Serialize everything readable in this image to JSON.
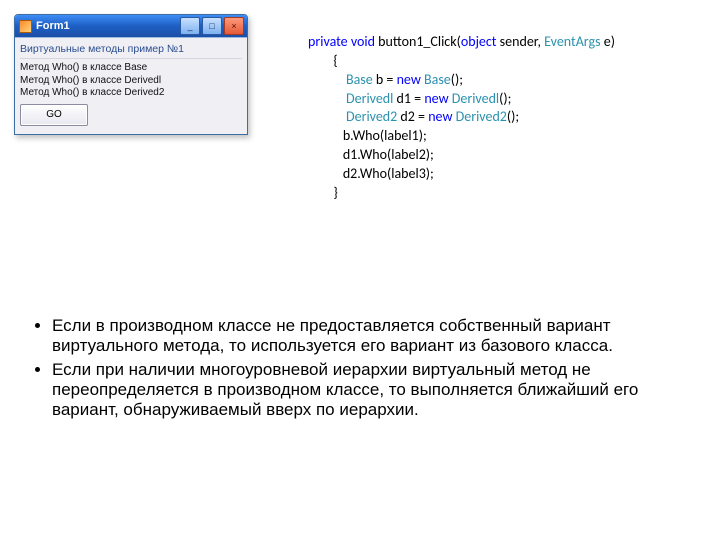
{
  "form": {
    "title": "Form1",
    "heading": "Виртуальные методы пример №1",
    "lines": [
      "Метод Who() в классе Base",
      "Метод Who() в классе Derivedl",
      "Метод Who() в классе Derived2"
    ],
    "go_label": "GO",
    "min_icon": "_",
    "max_icon": "□",
    "close_icon": "×"
  },
  "code": {
    "l1a": "private",
    "l1b": " void",
    "l1c": " button1_Click(",
    "l1d": "object",
    "l1e": " sender, ",
    "l1f": "EventArgs",
    "l1g": " e)",
    "l2": "        {",
    "l3a": "Base",
    "l3b": " b = ",
    "l3c": "new",
    "l3d": " Base",
    "l3e": "();",
    "l4a": "Derivedl",
    "l4b": " d1 = ",
    "l4c": "new",
    "l4d": " Derivedl",
    "l4e": "();",
    "l5a": "Derived2",
    "l5b": " d2 = ",
    "l5c": "new",
    "l5d": " Derived2",
    "l5e": "();",
    "l6": "           b.Who(label1);",
    "l7": "           d1.Who(label2);",
    "l8": "           d2.Who(label3);",
    "l9": "        }"
  },
  "bullets": {
    "b1": "Если в производном классе не предоставляется собственный вариант виртуального метода, то используется его вариант из базового класса.",
    "b2": " Если при наличии многоуровневой иерархии виртуальный метод не переопределяется в производном классе, то выполняется ближайший его вариант, обнаруживаемый вверх по иерархии."
  }
}
